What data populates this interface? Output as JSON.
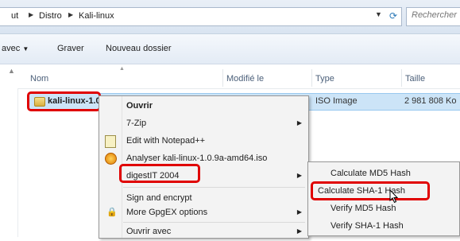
{
  "address_bar": {
    "crumbs": [
      "ut",
      "Distro",
      "Kali-linux"
    ],
    "search_placeholder": "Rechercher"
  },
  "toolbar": {
    "share_label": "avec",
    "burn_label": "Graver",
    "new_folder_label": "Nouveau dossier"
  },
  "columns": {
    "name": "Nom",
    "modified": "Modifié le",
    "type": "Type",
    "size": "Taille"
  },
  "file": {
    "name": "kali-linux-1.0",
    "type": "ISO Image",
    "size": "2 981 808 Ko"
  },
  "context_menu": {
    "open": "Ouvrir",
    "seven_zip": "7-Zip",
    "notepad": "Edit with Notepad++",
    "analyze": "Analyser kali-linux-1.0.9a-amd64.iso",
    "digestit": "digestIT 2004",
    "sign_encrypt": "Sign and encrypt",
    "gpgex": "More GpgEX options",
    "open_with": "Ouvrir avec"
  },
  "submenu": {
    "md5": "Calculate MD5 Hash",
    "sha1": "Calculate SHA-1 Hash",
    "verify_md5": "Verify MD5 Hash",
    "verify_sha1": "Verify SHA-1 Hash"
  },
  "colors": {
    "highlight_box": "#e00000",
    "selection": "#cce4f7"
  }
}
